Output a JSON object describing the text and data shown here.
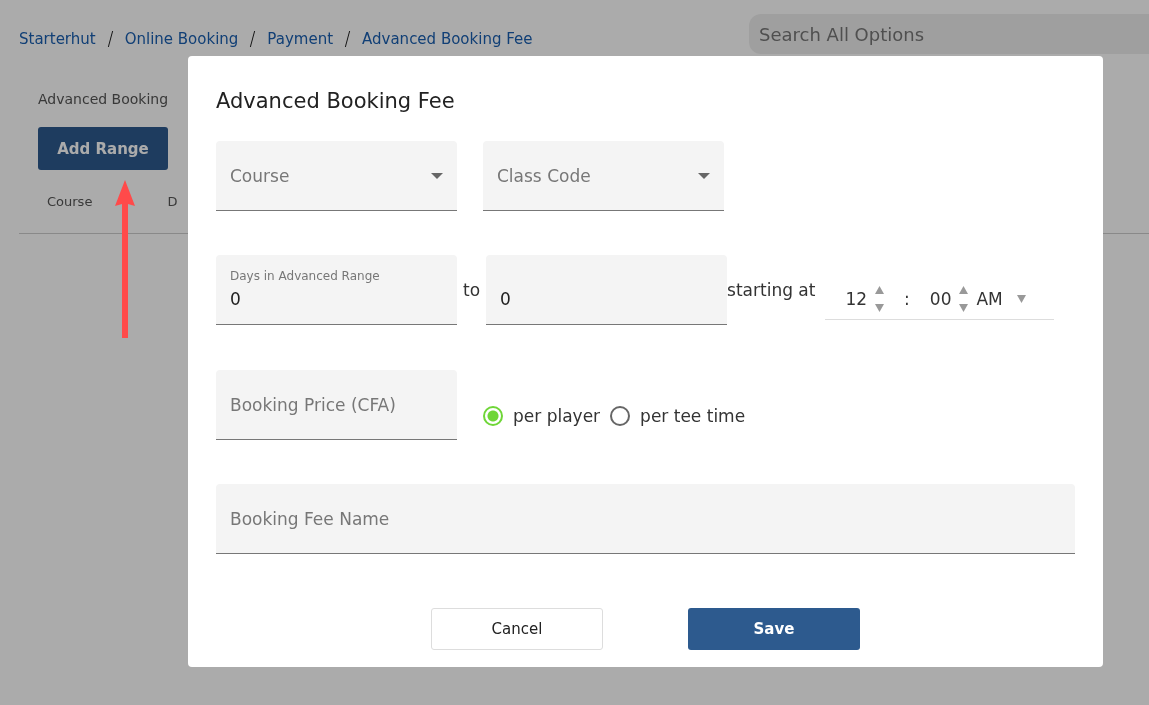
{
  "page": {
    "breadcrumb": [
      {
        "label": "Starterhut"
      },
      {
        "label": "Online Booking"
      },
      {
        "label": "Payment"
      },
      {
        "label": "Advanced Booking Fee"
      }
    ],
    "search": {
      "placeholder": "Search All Options"
    },
    "heading": "Advanced Booking",
    "add_button": "Add Range",
    "columns": [
      "Course",
      "D"
    ]
  },
  "dialog": {
    "title": "Advanced Booking Fee",
    "selects": [
      {
        "label": "Course"
      },
      {
        "label": "Class Code"
      }
    ],
    "days": {
      "label": "Days in Advanced Range",
      "from": "0",
      "joiner": "to",
      "to": "0"
    },
    "start": {
      "label": "starting at",
      "hour": "12",
      "separator": ":",
      "minute": "00",
      "period": "AM"
    },
    "price": {
      "placeholder": "Booking Price (CFA)"
    },
    "rate_options": [
      {
        "label": "per player",
        "selected": true
      },
      {
        "label": "per tee time",
        "selected": false
      }
    ],
    "name_field": {
      "placeholder": "Booking Fee Name"
    },
    "buttons": [
      {
        "label": "Cancel",
        "kind": "secondary"
      },
      {
        "label": "Save",
        "kind": "primary"
      }
    ]
  }
}
